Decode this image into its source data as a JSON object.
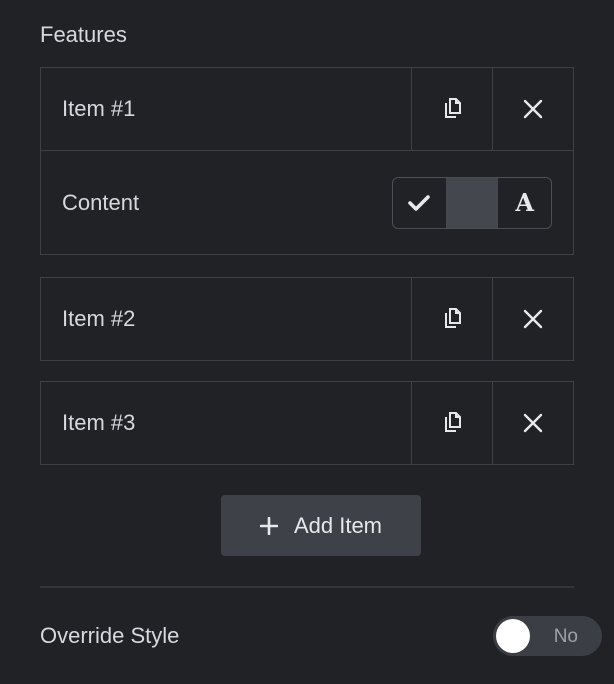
{
  "section": {
    "title": "Features"
  },
  "items": [
    {
      "label": "Item #1"
    },
    {
      "label": "Item #2"
    },
    {
      "label": "Item #3"
    }
  ],
  "item_actions": {
    "duplicate_icon": "copy-icon",
    "remove_icon": "close-icon"
  },
  "content_control": {
    "label": "Content",
    "options": [
      {
        "icon": "check-icon"
      },
      {
        "icon": "blank",
        "selected": true
      },
      {
        "text": "A",
        "icon": "text-icon"
      }
    ]
  },
  "add_button": {
    "label": "Add Item",
    "icon": "plus-icon"
  },
  "override": {
    "label": "Override Style",
    "toggle_text": "No",
    "enabled": false
  },
  "colors": {
    "background": "#202226",
    "border": "#3d4045",
    "accent_button": "#3e4147",
    "text": "#d5d8dc"
  }
}
